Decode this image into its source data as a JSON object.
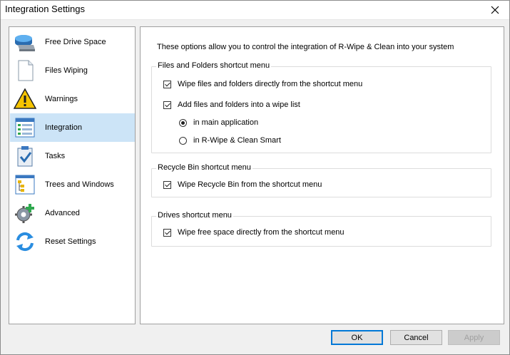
{
  "window": {
    "title": "Integration Settings"
  },
  "nav": {
    "items": [
      {
        "label": "Free Drive Space",
        "icon": "drive-icon",
        "selected": false
      },
      {
        "label": "Files Wiping",
        "icon": "document-icon",
        "selected": false
      },
      {
        "label": "Warnings",
        "icon": "warning-icon",
        "selected": false
      },
      {
        "label": "Integration",
        "icon": "integration-window-icon",
        "selected": true
      },
      {
        "label": "Tasks",
        "icon": "task-clipboard-icon",
        "selected": false
      },
      {
        "label": "Trees and Windows",
        "icon": "tree-window-icon",
        "selected": false
      },
      {
        "label": "Advanced",
        "icon": "gear-plus-icon",
        "selected": false
      },
      {
        "label": "Reset Settings",
        "icon": "reset-arrows-icon",
        "selected": false
      }
    ]
  },
  "main": {
    "intro": "These options allow you to control the integration of R-Wipe & Clean into your system",
    "files_group": {
      "title": "Files and Folders shortcut menu",
      "wipe_files": {
        "label": "Wipe files and folders directly from the shortcut menu",
        "checked": true
      },
      "add_to_list": {
        "label": "Add files and folders into a wipe list",
        "checked": true
      },
      "radio_main": {
        "label": "in main application",
        "checked": true
      },
      "radio_smart": {
        "label": "in R-Wipe & Clean Smart",
        "checked": false
      }
    },
    "recycle_group": {
      "title": "Recycle Bin shortcut menu",
      "wipe_recycle": {
        "label": "Wipe Recycle Bin from the shortcut menu",
        "checked": true
      }
    },
    "drives_group": {
      "title": "Drives shortcut menu",
      "wipe_free": {
        "label": "Wipe free space directly from the shortcut menu",
        "checked": true
      }
    }
  },
  "buttons": {
    "ok": "OK",
    "cancel": "Cancel",
    "apply": "Apply"
  },
  "colors": {
    "selected_bg": "#cce4f7",
    "accent": "#0078d7"
  }
}
